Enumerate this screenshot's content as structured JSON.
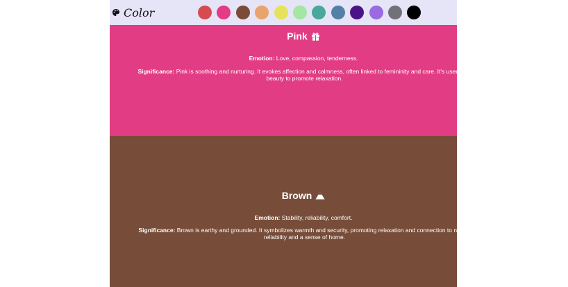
{
  "navbar": {
    "brand_text": "Color",
    "brand_icon": "palette-icon",
    "swatches": [
      {
        "name": "red",
        "color": "#d64b50"
      },
      {
        "name": "pink",
        "color": "#e23c84"
      },
      {
        "name": "brown",
        "color": "#7a4c36"
      },
      {
        "name": "orange",
        "color": "#e9a46e"
      },
      {
        "name": "yellow",
        "color": "#e6e25c"
      },
      {
        "name": "green",
        "color": "#a4e6a4"
      },
      {
        "name": "teal",
        "color": "#4aa79c"
      },
      {
        "name": "blue",
        "color": "#5480a8"
      },
      {
        "name": "indigo",
        "color": "#4b1387"
      },
      {
        "name": "purple",
        "color": "#9b6ae2"
      },
      {
        "name": "gray",
        "color": "#727079"
      },
      {
        "name": "black",
        "color": "#000000"
      }
    ]
  },
  "sections": {
    "pink": {
      "title": "Pink",
      "icon": "gift-icon",
      "bg": "#e23c84",
      "emotion_label": "Emotion:",
      "emotion_text": " Love, compassion, tenderness.",
      "significance_label": "Significance:",
      "significance_line1": " Pink is soothing and nurturing. It evokes affection and calmness, often linked to femininity and care. It's used in w",
      "significance_line2": "beauty to promote relaxation."
    },
    "brown": {
      "title": "Brown",
      "icon": "mountain-icon",
      "bg": "#774d39",
      "emotion_label": "Emotion:",
      "emotion_text": " Stability, reliability, comfort.",
      "significance_label": "Significance:",
      "significance_line1": " Brown is earthy and grounded. It symbolizes warmth and security, promoting relaxation and connection to nature",
      "significance_line2": "reliability and a sense of home."
    }
  }
}
